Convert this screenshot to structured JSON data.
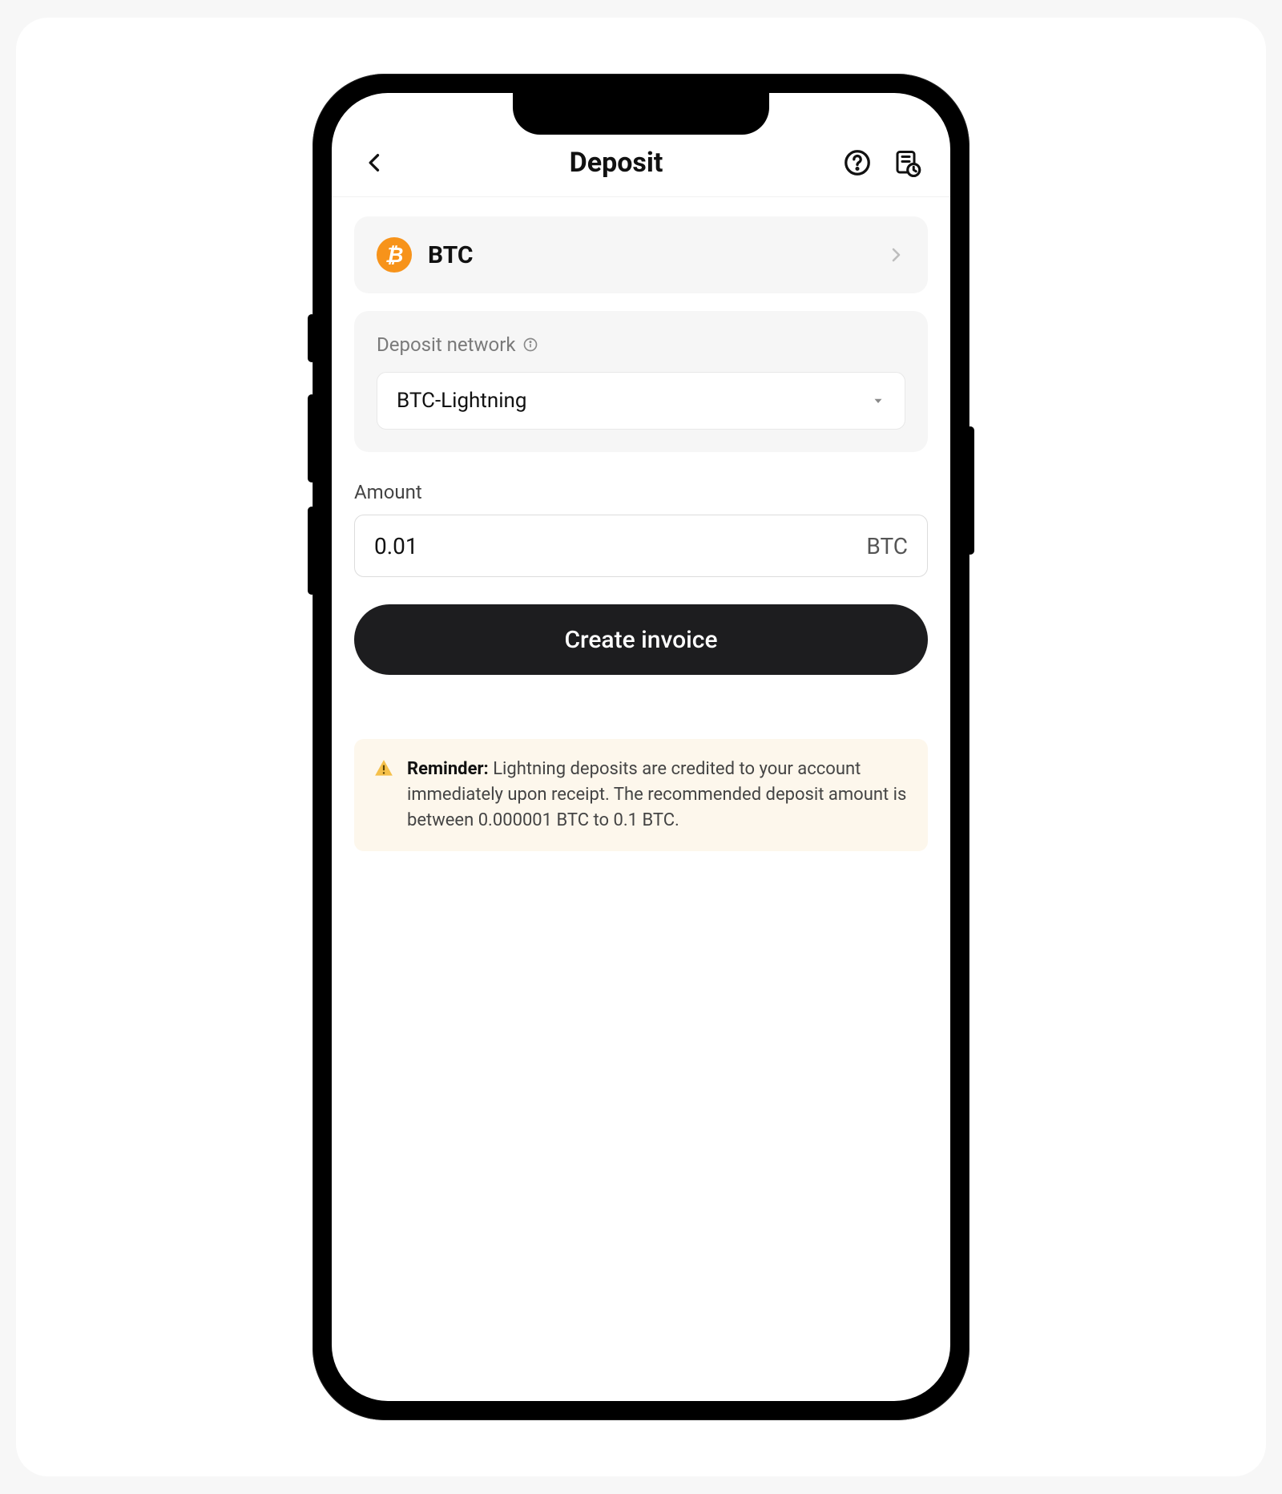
{
  "header": {
    "title": "Deposit"
  },
  "coin": {
    "symbol": "BTC",
    "iconGlyph": "₿"
  },
  "network": {
    "label": "Deposit network",
    "selected": "BTC-Lightning"
  },
  "amount": {
    "label": "Amount",
    "value": "0.01",
    "unit": "BTC"
  },
  "actions": {
    "create_invoice": "Create invoice"
  },
  "reminder": {
    "title": "Reminder:",
    "body": "Lightning deposits are credited to your account immediately upon receipt. The recommended deposit amount is between 0.000001 BTC to 0.1 BTC."
  }
}
